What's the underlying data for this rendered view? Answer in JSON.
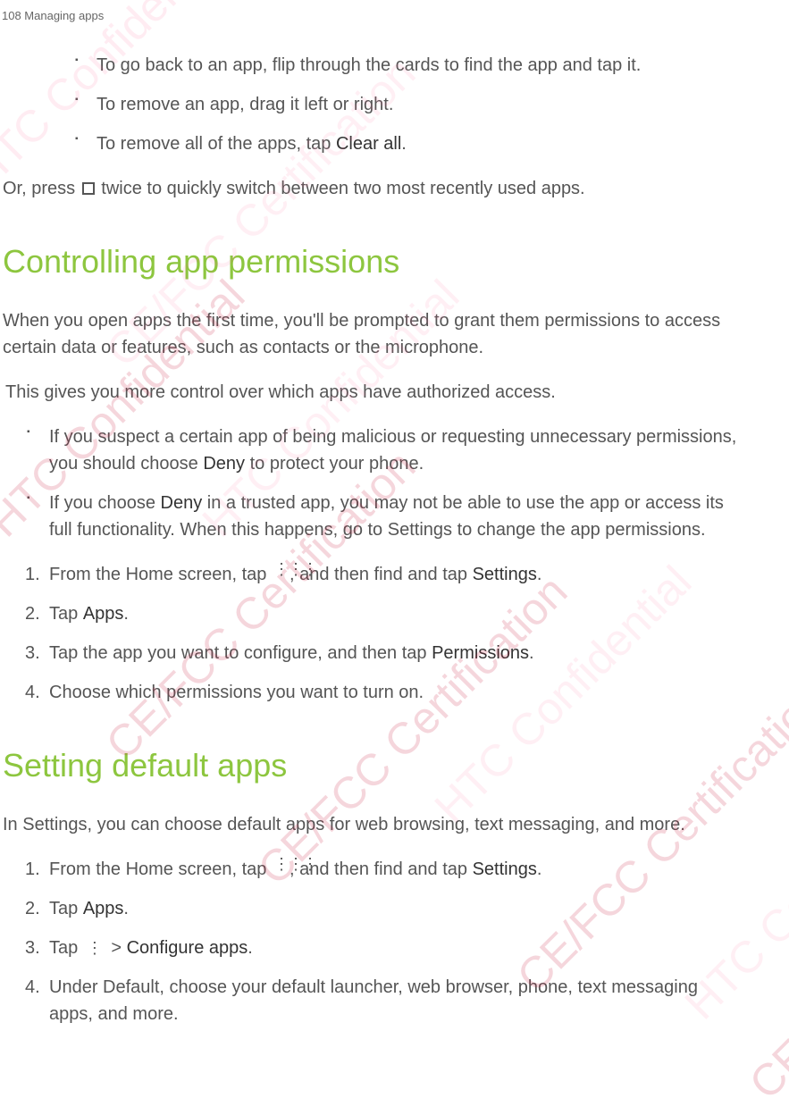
{
  "page_header": "108    Managing apps",
  "bullets1": {
    "item1": "To go back to an app, flip through the cards to find the app and tap it.",
    "item2": "To remove an app, drag it left or right.",
    "item3_prefix": "To remove all of the apps, tap ",
    "item3_bold": "Clear all",
    "item3_suffix": "."
  },
  "or_press": {
    "prefix": "Or, press ",
    "suffix": " twice to quickly switch between two most recently used apps."
  },
  "section1": {
    "heading": "Controlling app permissions",
    "p1": "When you open apps the first time, you'll be prompted to grant them permissions to access certain data or features, such as contacts or the microphone.",
    "p2": " This gives you more control over which apps have authorized access.",
    "bullet1_prefix": "If you suspect a certain app of being malicious or requesting unnecessary permissions, you should choose ",
    "bullet1_bold": "Deny",
    "bullet1_suffix": " to protect your phone.",
    "bullet2_prefix": "If you choose ",
    "bullet2_bold": "Deny",
    "bullet2_suffix": " in a trusted app, you may not be able to use the app or access its full functionality. When this happens, go to Settings to change the app permissions.",
    "step1_prefix": "From the Home screen, tap ",
    "step1_mid": ", and then find and tap ",
    "step1_bold": "Settings",
    "step1_suffix": ".",
    "step2_prefix": "Tap ",
    "step2_bold": "Apps",
    "step2_suffix": ".",
    "step3_prefix": "Tap the app you want to configure, and then tap ",
    "step3_bold": "Permissions",
    "step3_suffix": ".",
    "step4": "Choose which permissions you want to turn on."
  },
  "section2": {
    "heading": "Setting default apps",
    "p1": "In Settings, you can choose default apps for web browsing, text messaging, and more.",
    "step1_prefix": "From the Home screen, tap ",
    "step1_mid": ", and then find and tap ",
    "step1_bold": "Settings",
    "step1_suffix": ".",
    "step2_prefix": "Tap ",
    "step2_bold": "Apps",
    "step2_suffix": ".",
    "step3_prefix": "Tap  ",
    "step3_mid": "  > ",
    "step3_bold": "Configure apps",
    "step3_suffix": ".",
    "step4": "Under Default, choose your default launcher, web browser, phone, text messaging apps, and more."
  },
  "watermarks": {
    "conf": "HTC Confidential",
    "cert": "CE/FCC Certification"
  },
  "nums": {
    "n1": "1.",
    "n2": "2.",
    "n3": "3.",
    "n4": "4."
  }
}
